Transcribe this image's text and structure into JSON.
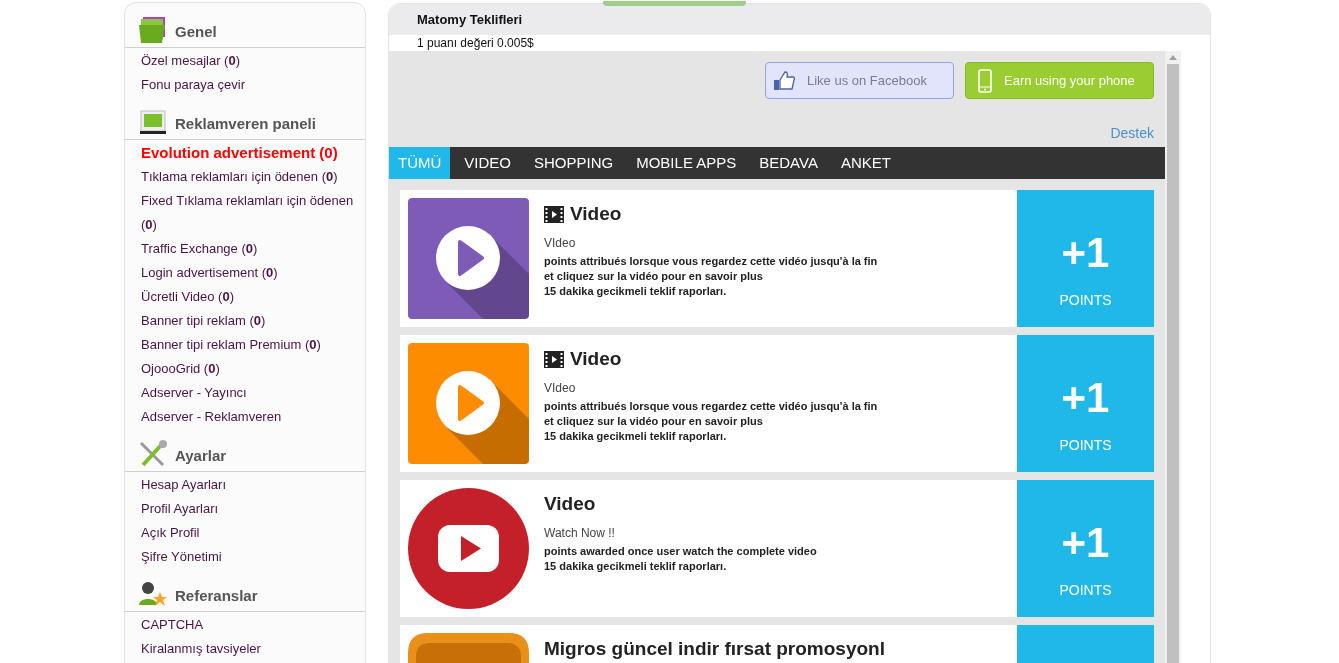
{
  "sidebar": {
    "sections": [
      {
        "title": "Genel",
        "items": [
          {
            "label": "Özel mesajlar (**0**)",
            "selected": false
          },
          {
            "label": "Fonu paraya çevir",
            "selected": false
          }
        ]
      },
      {
        "title": "Reklamveren paneli",
        "items": [
          {
            "label": "Evolution advertisement (0)",
            "selected": true
          },
          {
            "label": "Tıklama reklamları için ödenen (**0**)",
            "selected": false
          },
          {
            "label": "Fixed Tıklama reklamları için ödenen (**0**)",
            "selected": false
          },
          {
            "label": "Traffic Exchange (**0**)",
            "selected": false
          },
          {
            "label": "Login advertisement (**0**)",
            "selected": false
          },
          {
            "label": "Ücretli Video (**0**)",
            "selected": false
          },
          {
            "label": "Banner tipi reklam (**0**)",
            "selected": false
          },
          {
            "label": "Banner tipi reklam Premium (**0**)",
            "selected": false
          },
          {
            "label": "OjoooGrid (**0**)",
            "selected": false
          },
          {
            "label": "Adserver - Yayıncı",
            "selected": false
          },
          {
            "label": "Adserver - Reklamveren",
            "selected": false
          }
        ]
      },
      {
        "title": "Ayarlar",
        "items": [
          {
            "label": "Hesap Ayarları",
            "selected": false
          },
          {
            "label": "Profil Ayarları",
            "selected": false
          },
          {
            "label": "Açık Profil",
            "selected": false
          },
          {
            "label": "Şifre Yönetimi",
            "selected": false
          }
        ]
      },
      {
        "title": "Referanslar",
        "items": [
          {
            "label": "CAPTCHA",
            "selected": false
          },
          {
            "label": "Kiralanmış tavsiyeler",
            "selected": false
          }
        ]
      }
    ]
  },
  "panel": {
    "title": "Matomy Teklifleri",
    "point_value": "1 puanı değeri 0.005$",
    "buttons": [
      {
        "kind": "facebook",
        "label": "Like us on Facebook"
      },
      {
        "kind": "phone",
        "label": "Earn using your phone"
      }
    ],
    "support_link": "Destek",
    "tabs": [
      {
        "label": "TÜMÜ",
        "selected": true
      },
      {
        "label": "VIDEO",
        "selected": false
      },
      {
        "label": "SHOPPING",
        "selected": false
      },
      {
        "label": "MOBILE APPS",
        "selected": false
      },
      {
        "label": "BEDAVA",
        "selected": false
      },
      {
        "label": "ANKET",
        "selected": false
      }
    ],
    "offers": [
      {
        "kind": "play",
        "color": "#7e5bb6",
        "film_icon": true,
        "title": "Video",
        "subtitle": "VIdeo",
        "description": [
          "points attribués lorsque vous regardez cette vidéo jusqu'à la fin",
          "et cliquez sur la vidéo pour en savoir plus",
          "15 dakika gecikmeli teklif raporları."
        ],
        "points": "+1",
        "points_label": "POINTS"
      },
      {
        "kind": "play",
        "color": "#fe8c00",
        "film_icon": true,
        "title": "Video",
        "subtitle": "VIdeo",
        "description": [
          "points attribués lorsque vous regardez cette vidéo jusqu'à la fin",
          "et cliquez sur la vidéo pour en savoir plus",
          "15 dakika gecikmeli teklif raporları."
        ],
        "points": "+1",
        "points_label": "POINTS"
      },
      {
        "kind": "tube",
        "color": "#c4202a",
        "film_icon": false,
        "title": "Video",
        "subtitle": "Watch Now !!",
        "description": [
          "points awarded once user watch the complete video",
          "15 dakika gecikmeli teklif raporları."
        ],
        "points": "+1",
        "points_label": "POINTS"
      },
      {
        "kind": "app",
        "color": "#e8901a",
        "film_icon": false,
        "title": "Migros güncel indir fırsat promosyonl"
      }
    ]
  }
}
